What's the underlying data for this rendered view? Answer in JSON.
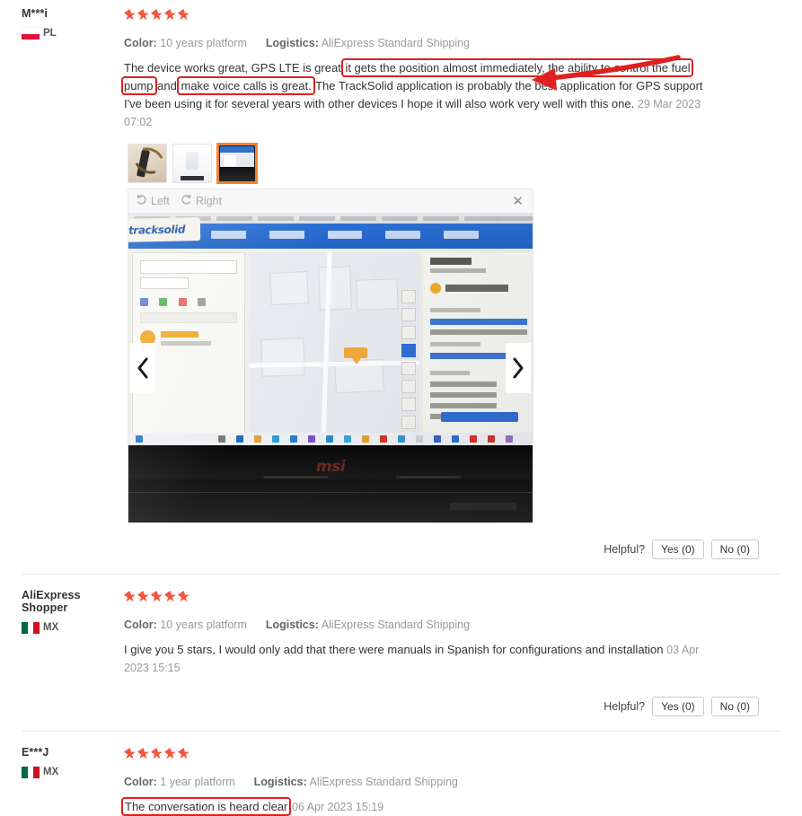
{
  "colors": {
    "star": "#f2573f",
    "annotation": "#e02020",
    "thumb_selected": "#f08437",
    "link_muted": "#999999"
  },
  "labels": {
    "color_key": "Color:",
    "logistics_key": "Logistics:",
    "helpful": "Helpful?",
    "yes": "Yes (0)",
    "no": "No (0)",
    "rotate_left": "Left",
    "rotate_right": "Right",
    "close": "✕"
  },
  "icons": {
    "rotate_left": "rotate-left-icon",
    "rotate_right": "rotate-right-icon",
    "close": "close-icon",
    "prev": "chevron-left-icon",
    "next": "chevron-right-icon",
    "star": "star-icon",
    "flag_pl": "flag-poland-icon",
    "flag_mx": "flag-mexico-icon"
  },
  "reviews": [
    {
      "name": "M***i",
      "country": "PL",
      "flag": "pl",
      "rating": 5,
      "color": "10 years platform",
      "logistics": "AliExpress Standard Shipping",
      "text_part_1": "The device works great, GPS LTE is great",
      "text_highlight_1": "it gets the position almost immediately, the ability to control the fuel pump",
      "text_part_2": "and",
      "text_highlight_2": "make voice calls is great.",
      "text_part_3": "The TrackSolid application is probably the best application for GPS support I've been using it for several years with other devices I hope it will also work very well with this one.",
      "timestamp": "29 Mar 2023 07:02",
      "thumbnails": [
        {
          "name": "gps-tracker-device-photo",
          "selected": false
        },
        {
          "name": "packaging-document-photo",
          "selected": false
        },
        {
          "name": "laptop-tracksolid-screen-photo",
          "selected": true
        }
      ],
      "lightbox": {
        "app_logo": "tracksolid",
        "laptop_brand": "msi"
      },
      "helpful": {
        "yes": "Yes (0)",
        "no": "No (0)"
      }
    },
    {
      "name": "AliExpress Shopper",
      "country": "MX",
      "flag": "mx",
      "rating": 5,
      "color": "10 years platform",
      "logistics": "AliExpress Standard Shipping",
      "text_part_3": "I give you 5 stars, I would only add that there were manuals in Spanish for configurations and installation",
      "timestamp": "03 Apr 2023 15:15",
      "helpful": {
        "yes": "Yes (0)",
        "no": "No (0)"
      }
    },
    {
      "name": "E***J",
      "country": "MX",
      "flag": "mx",
      "rating": 5,
      "color": "1 year platform",
      "logistics": "AliExpress Standard Shipping",
      "text_highlight_1": "The conversation is heard clear",
      "timestamp": "06 Apr 2023 15:19"
    }
  ]
}
